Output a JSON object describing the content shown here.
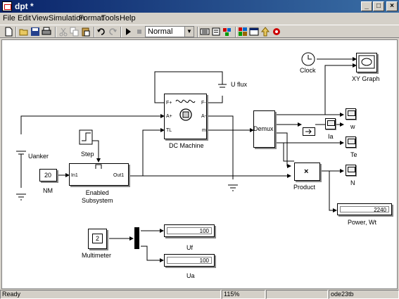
{
  "window": {
    "title": "dpt *",
    "min": "_",
    "max": "□",
    "close": "×"
  },
  "menu": [
    "File",
    "Edit",
    "View",
    "Simulation",
    "Format",
    "Tools",
    "Help"
  ],
  "toolbar": {
    "sim_mode": "Normal"
  },
  "blocks": {
    "clock": "Clock",
    "xy_graph": "XY Graph",
    "u_flux": "U flux",
    "dc_machine": "DC Machine",
    "dc_ports_left": [
      "F+",
      "A+",
      "TL"
    ],
    "dc_ports_right": [
      "F-",
      "A-",
      "m"
    ],
    "demux": "Demux",
    "uanker": "Uanker",
    "step": "Step",
    "nm_value": "20",
    "nm_label": "NM",
    "enabled_subsystem": "Enabled\nSubsystem",
    "subsys_in": "In1",
    "subsys_out": "Out1",
    "ia": "Ia",
    "w": "w",
    "te": "Te",
    "n": "N",
    "product": "Product",
    "product_symbol": "×",
    "power_value": "2240",
    "power_label": "Power, Wt",
    "multimeter_value": "2",
    "multimeter_label": "Multimeter",
    "uf_value": "100",
    "uf_label": "Uf",
    "ua_value": "100",
    "ua_label": "Ua"
  },
  "status": {
    "state": "Ready",
    "zoom": "115%",
    "solver": "ode23tb"
  }
}
